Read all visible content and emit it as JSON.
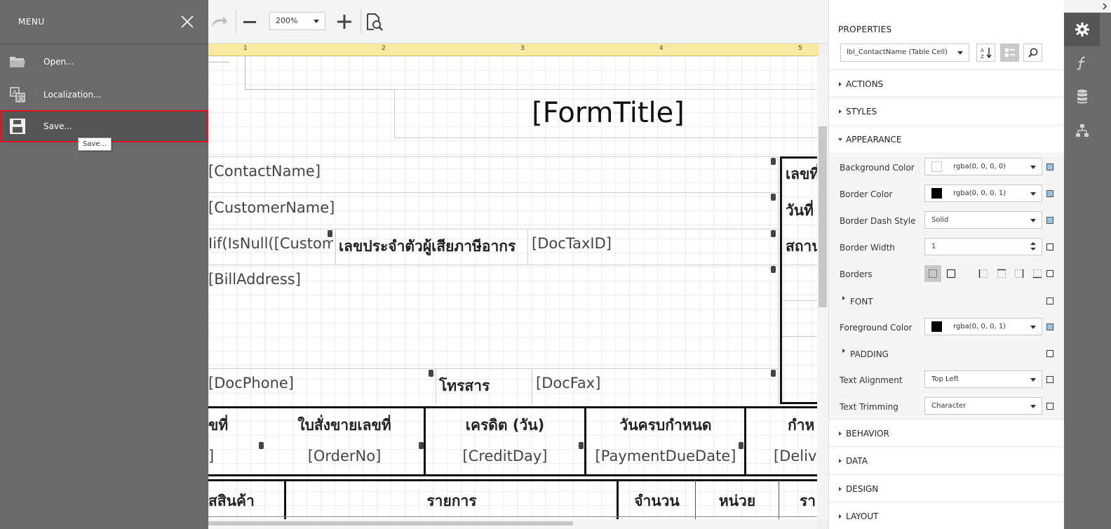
{
  "menu": {
    "title": "MENU",
    "items": [
      {
        "label": "Open...",
        "icon": "folder-icon"
      },
      {
        "label": "Localization...",
        "icon": "localization-icon"
      },
      {
        "label": "Save...",
        "icon": "save-icon"
      }
    ],
    "tooltip": "Save..."
  },
  "toolbar": {
    "zoom": "200%"
  },
  "ruler": {
    "marks": [
      "1",
      "2",
      "3",
      "4",
      "5"
    ]
  },
  "report": {
    "title": "[FormTitle]",
    "contact_name": "[ContactName]",
    "customer_name": "[CustomerName]",
    "iif_expr": "Iif(IsNull([Custom",
    "tax_id_label": "เลขประจำตัวผู้เสียภาษีอากร",
    "doc_tax_id": "[DocTaxID]",
    "bill_address": "[BillAddress]",
    "doc_phone": "[DocPhone]",
    "fax_label": "โทรสาร",
    "doc_fax": "[DocFax]",
    "right_label_1": "เลขที่",
    "right_label_2": "วันที่",
    "right_label_3": "สถาน",
    "header_row": {
      "h1": "ขที่",
      "h2": "ใบสั่งขายเลขที่",
      "h3": "เครดิต (วัน)",
      "h4": "วันครบกำหนด",
      "h5": "กำห"
    },
    "value_row": {
      "v1": "]",
      "v2": "[OrderNo]",
      "v3": "[CreditDay]",
      "v4": "[PaymentDueDate]",
      "v5": "[Delive"
    },
    "item_header": {
      "c1": "สสินค้า",
      "c2": "รายการ",
      "c3": "จำนวน",
      "c4": "หน่วย",
      "c5": "รา"
    }
  },
  "properties": {
    "title": "PROPERTIES",
    "selected": "lbl_ContactName (Table Cell)",
    "sections": {
      "actions": "ACTIONS",
      "styles": "STYLES",
      "appearance": "APPEARANCE",
      "behavior": "BEHAVIOR",
      "data": "DATA",
      "design": "DESIGN",
      "layout": "LAYOUT"
    },
    "rows": {
      "background_color": {
        "label": "Background Color",
        "value": "rgba(0, 0, 0, 0)",
        "swatch": "#ffffff"
      },
      "border_color": {
        "label": "Border Color",
        "value": "rgba(0, 0, 0, 1)",
        "swatch": "#000000"
      },
      "border_dash_style": {
        "label": "Border Dash Style",
        "value": "Solid"
      },
      "border_width": {
        "label": "Border Width",
        "value": "1"
      },
      "borders": {
        "label": "Borders"
      },
      "font": {
        "label": "FONT"
      },
      "foreground_color": {
        "label": "Foreground Color",
        "value": "rgba(0, 0, 0, 1)",
        "swatch": "#000000"
      },
      "padding": {
        "label": "PADDING"
      },
      "text_alignment": {
        "label": "Text Alignment",
        "value": "Top Left"
      },
      "text_trimming": {
        "label": "Text Trimming",
        "value": "Character"
      }
    }
  },
  "colors": {
    "menu_bg": "#6a6a6a",
    "highlight": "#e0141e",
    "ruler": "#f8e9a1"
  }
}
